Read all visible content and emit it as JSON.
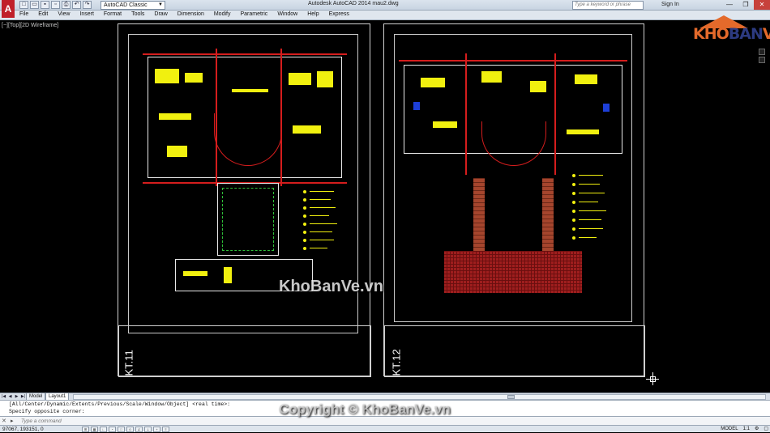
{
  "app": {
    "logo_letter": "A",
    "workspace": "AutoCAD Classic",
    "window_title": "Autodesk AutoCAD 2014    mau2.dwg",
    "search_placeholder": "Type a keyword or phrase",
    "signin": "Sign In"
  },
  "menu": [
    "File",
    "Edit",
    "View",
    "Insert",
    "Format",
    "Tools",
    "Draw",
    "Dimension",
    "Modify",
    "Parametric",
    "Window",
    "Help",
    "Express"
  ],
  "viewport": {
    "label": "[−][Top][2D Wireframe]"
  },
  "sheets": [
    {
      "name": "KT.11"
    },
    {
      "name": "KT.12"
    }
  ],
  "watermark": {
    "center": "KhoBanVe.vn",
    "copyright": "Copyright © KhoBanVe.vn",
    "logo_part1": "KHO",
    "logo_part2": "BAN",
    "logo_part3": "VẼ"
  },
  "tabs": [
    "Model",
    "Layout1"
  ],
  "active_tab": "Layout1",
  "command": {
    "history": [
      "[All/Center/Dynamic/Extents/Previous/Scale/Window/Object] <real time>:",
      "Specify opposite corner:"
    ],
    "placeholder": "Type a command"
  },
  "status": {
    "coords": "97067, 193151, 0",
    "model_label": "MODEL",
    "scale": "1:1"
  },
  "colors": {
    "background": "#000000",
    "line_yellow": "#f1f00f",
    "line_red": "#d51d1d",
    "brick": "#a5452d",
    "logo_orange": "#e46a2b"
  }
}
